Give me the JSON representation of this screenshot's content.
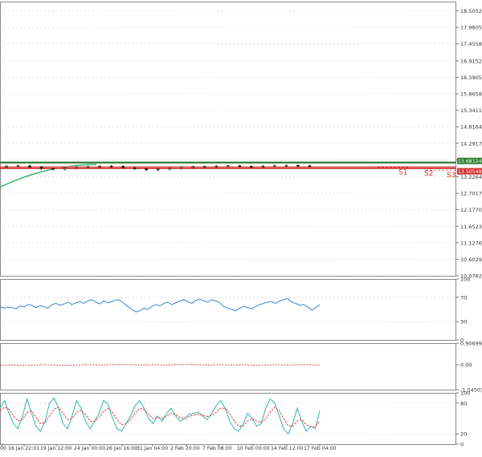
{
  "chart_data": [
    {
      "type": "candlestick",
      "panel": "main",
      "ylim": [
        10.0782,
        18.8
      ],
      "y_ticks": [
        "18.50520",
        "17.98050",
        "17.45580",
        "16.91520",
        "16.39050",
        "15.86580",
        "15.34110",
        "14.81640",
        "14.29170",
        "13.76700",
        "13.22640",
        "12.70170",
        "12.17700",
        "11.65230",
        "11.12760",
        "10.60290",
        "10.07820"
      ],
      "price_labels": [
        {
          "label": "13.68124",
          "value": 13.68124,
          "color": "#2e7d32"
        },
        {
          "label": "13.50548",
          "value": 13.50548,
          "color": "#d32f2f"
        }
      ],
      "levels": [
        {
          "name": "S1",
          "value": 13.54,
          "color": "#d32f2f"
        },
        {
          "name": "S2",
          "value": 13.49,
          "color": "#d32f2f"
        },
        {
          "name": "S3",
          "value": 13.44,
          "color": "#d32f2f"
        }
      ],
      "ma": {
        "color": "#2fb36a",
        "start": 12.9,
        "end": 13.62
      },
      "price_path": [
        13.55,
        13.57,
        13.58,
        13.54,
        13.49,
        13.47,
        13.5,
        13.53,
        13.55,
        13.57,
        13.56,
        13.52,
        13.48,
        13.45,
        13.47,
        13.5,
        13.53,
        13.55,
        13.56,
        13.57,
        13.58,
        13.56,
        13.55,
        13.57,
        13.58,
        13.59,
        13.58,
        13.56
      ]
    },
    {
      "type": "line",
      "panel": "rsi",
      "ylim": [
        0,
        100
      ],
      "y_ticks": [
        "100",
        "70",
        "30",
        "0"
      ],
      "series": [
        {
          "color": "#3d85d6",
          "values": [
            55,
            52,
            54,
            53,
            51,
            56,
            54,
            58,
            57,
            53,
            56,
            55,
            52,
            58,
            60,
            57,
            59,
            62,
            58,
            61,
            63,
            60,
            64,
            66,
            62,
            59,
            64,
            61,
            63,
            66,
            65,
            60,
            55,
            50,
            46,
            48,
            52,
            50,
            55,
            58,
            56,
            60,
            62,
            58,
            61,
            64,
            66,
            63,
            60,
            65,
            67,
            64,
            62,
            66,
            64,
            61,
            55,
            52,
            50,
            48,
            52,
            55,
            53,
            51,
            55,
            58,
            60,
            62,
            63,
            60,
            64,
            66,
            68,
            62,
            60,
            57,
            58,
            54,
            49,
            53,
            58
          ]
        }
      ]
    },
    {
      "type": "line",
      "panel": "macd",
      "ylim": [
        -1.045035,
        0.906998
      ],
      "y_ticks": [
        "0.906998",
        "0.00",
        "-1.045035"
      ],
      "series": [
        {
          "color": "#d32f2f",
          "values": [
            -0.02,
            -0.01,
            -0.02,
            -0.01,
            0.0,
            -0.01,
            -0.02,
            -0.01,
            0.0,
            -0.01,
            0.0,
            0.01,
            0.0,
            -0.01,
            0.0,
            -0.01,
            0.0,
            0.01,
            0.0,
            -0.01,
            0.0,
            -0.01,
            0.0,
            -0.02,
            -0.01,
            0.0,
            -0.01,
            0.0,
            0.0,
            -0.01
          ]
        }
      ]
    },
    {
      "type": "line",
      "panel": "stochastic",
      "ylim": [
        0,
        100
      ],
      "y_ticks": [
        "100",
        "80",
        "20",
        "0"
      ],
      "x_ticks": [
        "00",
        "16 Jan 22:01",
        "19 Jan 12:00",
        "24 Jan 00:00",
        "26 Jan 16:00",
        "31 Jan 04:00",
        "2 Feb 20:00",
        "7 Feb 08:00",
        "10 Feb 00:00",
        "14 Feb 12:00",
        "17 Feb 04:00"
      ],
      "series": [
        {
          "color": "#2bb5b8",
          "values": [
            70,
            85,
            60,
            40,
            30,
            55,
            88,
            60,
            35,
            25,
            45,
            80,
            90,
            70,
            40,
            30,
            55,
            85,
            70,
            45,
            30,
            45,
            60,
            85,
            78,
            50,
            30,
            25,
            40,
            55,
            75,
            85,
            70,
            50,
            40,
            55,
            45,
            60,
            70,
            55,
            45,
            50,
            58,
            60,
            62,
            55,
            48,
            60,
            75,
            85,
            70,
            45,
            30,
            25,
            40,
            60,
            50,
            35,
            40,
            70,
            88,
            80,
            55,
            30,
            20,
            40,
            70,
            45,
            25,
            35,
            30,
            65
          ]
        },
        {
          "color": "#e53935",
          "values": [
            65,
            72,
            68,
            55,
            45,
            48,
            62,
            65,
            52,
            40,
            42,
            55,
            68,
            72,
            60,
            48,
            50,
            62,
            66,
            58,
            45,
            44,
            52,
            64,
            70,
            62,
            48,
            38,
            40,
            48,
            60,
            70,
            68,
            58,
            50,
            52,
            50,
            55,
            60,
            58,
            52,
            50,
            54,
            57,
            58,
            57,
            54,
            56,
            62,
            70,
            70,
            60,
            45,
            35,
            35,
            45,
            50,
            45,
            42,
            50,
            62,
            72,
            66,
            50,
            36,
            35,
            45,
            48,
            38,
            34,
            34,
            45
          ]
        }
      ]
    }
  ]
}
